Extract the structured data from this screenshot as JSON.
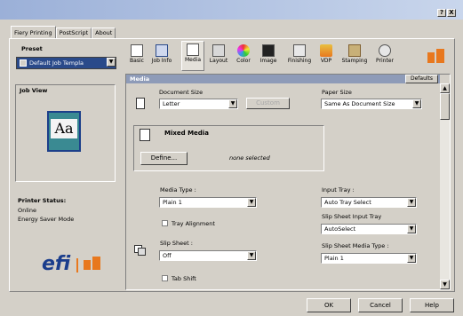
{
  "window": {
    "help_button": "?",
    "close_button": "X"
  },
  "tabs": [
    "Fiery Printing",
    "PostScript",
    "About"
  ],
  "preset": {
    "label": "Preset",
    "value": "Default Job Templa"
  },
  "toolbar": {
    "items": [
      "Basic",
      "Job Info",
      "Media",
      "Layout",
      "Color",
      "Image",
      "Finishing",
      "VDP",
      "Stamping",
      "Printer"
    ],
    "defaults_label": "Defaults"
  },
  "section_title": "Media",
  "job_view": {
    "label": "Job View",
    "preview_text": "Aa"
  },
  "printer_status": {
    "label": "Printer Status:",
    "lines": [
      "Online",
      "Energy Saver Mode"
    ]
  },
  "brand": {
    "logo_text": "efi"
  },
  "document_size": {
    "label": "Document Size",
    "value": "Letter",
    "custom_button": "Custom"
  },
  "paper_size": {
    "label": "Paper Size",
    "value": "Same As Document Size"
  },
  "mixed_media": {
    "label": "Mixed Media",
    "define_button": "Define...",
    "status": "none selected"
  },
  "media_type": {
    "label": "Media Type :",
    "value": "Plain 1"
  },
  "tray_alignment": {
    "label": "Tray Alignment"
  },
  "input_tray": {
    "label": "Input Tray :",
    "value": "Auto Tray Select"
  },
  "slip_sheet_input_tray": {
    "label": "Slip Sheet Input Tray",
    "value": "AutoSelect"
  },
  "slip_sheet": {
    "label": "Slip Sheet :",
    "value": "Off"
  },
  "slip_sheet_media_type": {
    "label": "Slip Sheet Media Type :",
    "value": "Plain 1"
  },
  "tab_shift": {
    "label": "Tab Shift"
  },
  "footer": {
    "ok": "OK",
    "cancel": "Cancel",
    "help": "Help"
  },
  "colors": {
    "section_header": "#8e9bb8",
    "accent_orange": "#e8781e",
    "logo_blue": "#1a3d8c",
    "preview_teal": "#3a8a92"
  }
}
